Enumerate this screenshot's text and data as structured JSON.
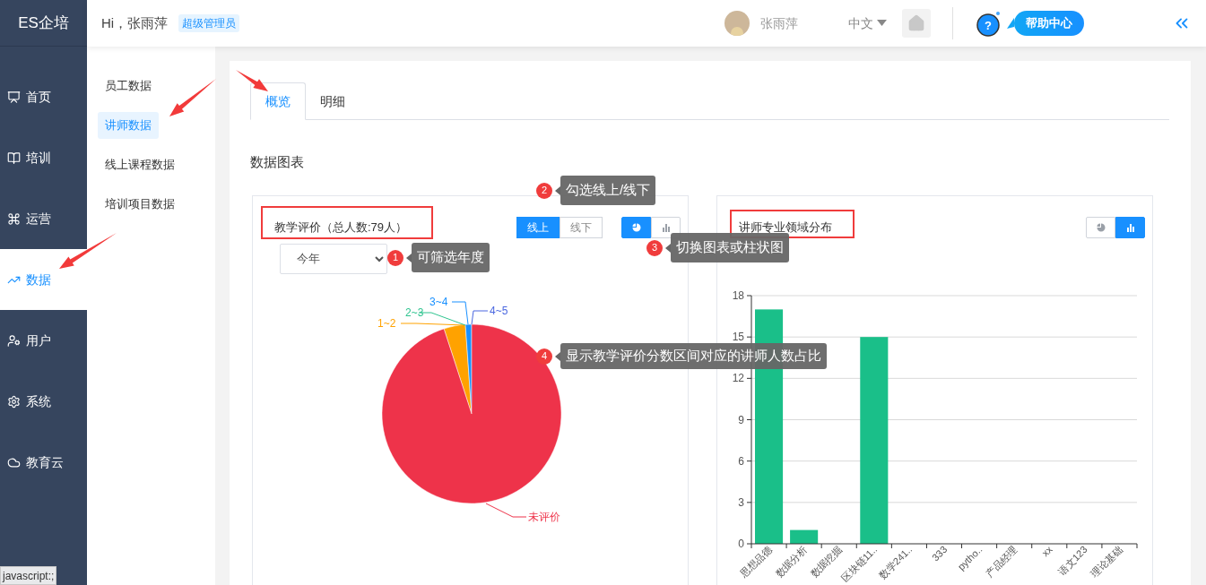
{
  "sidebar": {
    "logo": "ES企培",
    "items": [
      {
        "label": "首页",
        "selected": false
      },
      {
        "label": "培训",
        "selected": false
      },
      {
        "label": "运营",
        "selected": false
      },
      {
        "label": "数据",
        "selected": true
      },
      {
        "label": "用户",
        "selected": false
      },
      {
        "label": "系统",
        "selected": false
      },
      {
        "label": "教育云",
        "selected": false
      }
    ]
  },
  "header": {
    "greeting": "Hi，张雨萍",
    "role_badge": "超级管理员",
    "user_name": "张雨萍",
    "language": "中文",
    "help_button": "帮助中心",
    "help_mark": "?"
  },
  "subnav": {
    "items": [
      {
        "label": "员工数据",
        "selected": false
      },
      {
        "label": "讲师数据",
        "selected": true
      },
      {
        "label": "线上课程数据",
        "selected": false
      },
      {
        "label": "培训项目数据",
        "selected": false
      }
    ]
  },
  "tabs": [
    {
      "label": "概览",
      "selected": true
    },
    {
      "label": "明细",
      "selected": false
    }
  ],
  "section_title": "数据图表",
  "panels": [
    {
      "title": "教学评价（总人数:79人）",
      "mode_toggle": [
        {
          "label": "线上",
          "selected": true
        },
        {
          "label": "线下",
          "selected": false
        }
      ],
      "chart_switch": [
        {
          "kind": "pie",
          "selected": true
        },
        {
          "kind": "bar",
          "selected": false
        }
      ],
      "year_select": {
        "value": "今年"
      },
      "pie_labels": [
        {
          "label": "1~2",
          "color": "#ffa200"
        },
        {
          "label": "2~3",
          "color": "#2ec48f"
        },
        {
          "label": "3~4",
          "color": "#1890ff"
        },
        {
          "label": "4~5",
          "color": "#4a67e0"
        },
        {
          "label": "未评价",
          "color": "#ee334a"
        }
      ]
    },
    {
      "title": "讲师专业领域分布",
      "chart_switch": [
        {
          "kind": "pie",
          "selected": false
        },
        {
          "kind": "bar",
          "selected": true
        }
      ],
      "chart_data": {
        "type": "bar",
        "categories": [
          "思想品德",
          "数据分析",
          "数据挖掘",
          "区块链11..",
          "数学241..",
          "333",
          "pytho..",
          "产品经理",
          "xx",
          "语文123",
          "理论基础"
        ],
        "series": [
          {
            "color": "#1abf89",
            "values": [
              17,
              1,
              0,
              15,
              0,
              0,
              0,
              0,
              0,
              0,
              0
            ]
          }
        ],
        "ylim": [
          0,
          18
        ],
        "yticks": [
          0,
          3,
          6,
          9,
          12,
          15,
          18
        ],
        "grid": true
      }
    }
  ],
  "callouts": [
    {
      "number": "1",
      "text": "可筛选年度"
    },
    {
      "number": "2",
      "text": "勾选线上/线下"
    },
    {
      "number": "3",
      "text": "切换图表或柱状图"
    },
    {
      "number": "4",
      "text": "显示教学评价分数区间对应的讲师人数占比"
    }
  ],
  "status_bar": "javascript:;"
}
